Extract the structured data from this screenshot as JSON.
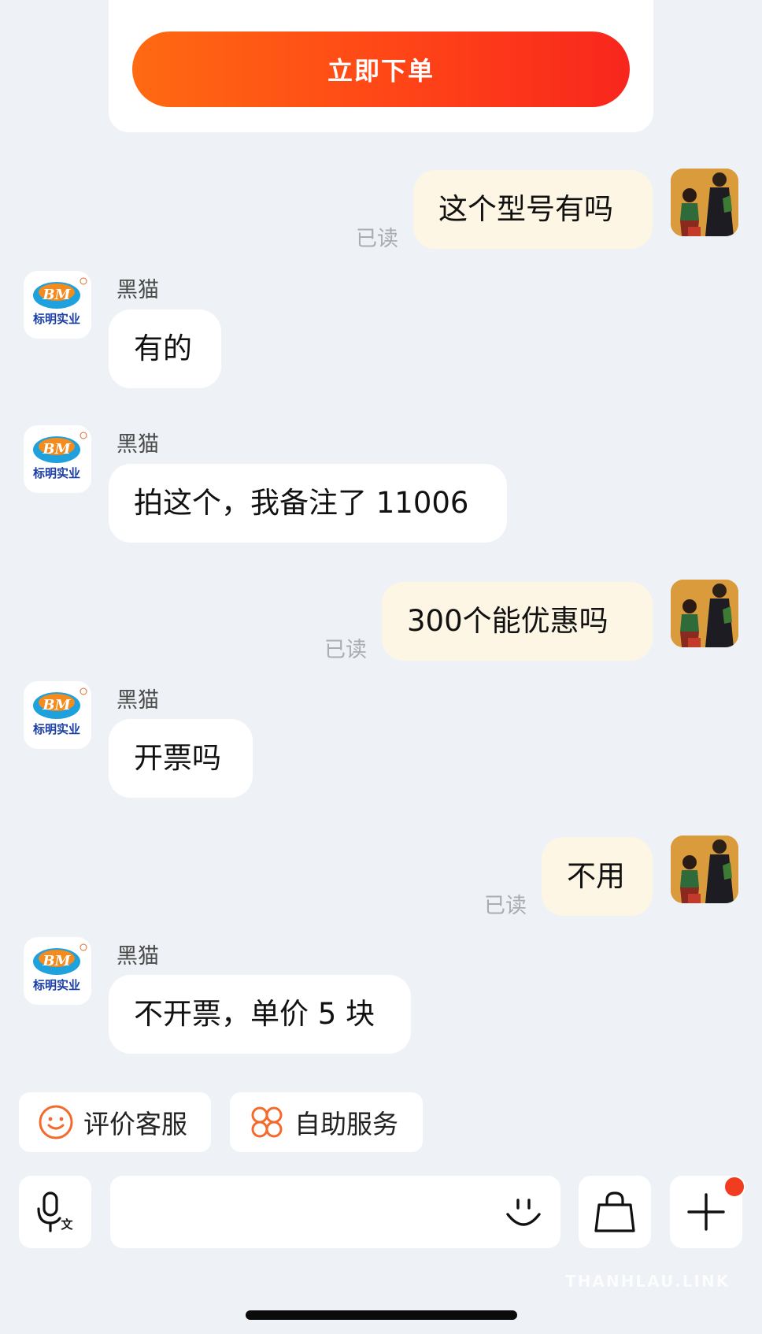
{
  "order_button": {
    "label": "立即下单"
  },
  "shop": {
    "logo_text_top": "BM",
    "logo_text_bottom": "标明实业"
  },
  "messages": [
    {
      "side": "out",
      "text": "这个型号有吗",
      "status": "已读"
    },
    {
      "side": "in",
      "sender": "黑猫",
      "text": "有的"
    },
    {
      "side": "in",
      "sender": "黑猫",
      "text": "拍这个，我备注了 11006"
    },
    {
      "side": "out",
      "text": "300个能优惠吗",
      "status": "已读"
    },
    {
      "side": "in",
      "sender": "黑猫",
      "text": "开票吗"
    },
    {
      "side": "out",
      "text": "不用",
      "status": "已读"
    },
    {
      "side": "in",
      "sender": "黑猫",
      "text": "不开票，单价 5 块"
    }
  ],
  "quick_actions": [
    {
      "label": "评价客服",
      "icon": "smiley-icon"
    },
    {
      "label": "自助服务",
      "icon": "self-service-icon"
    }
  ],
  "input_bar": {
    "voice_icon": "voice-input-icon",
    "voice_glyph": "文",
    "placeholder": "",
    "emoji_icon": "emoji-icon",
    "bag_icon": "shopping-bag-icon",
    "plus_icon": "plus-icon",
    "has_notification_dot": true
  },
  "watermark": "THANHLAU.LINK",
  "colors": {
    "accent_start": "#ff6a12",
    "accent_end": "#f8261d",
    "background": "#eef2f7",
    "outgoing_bubble": "#fdf6e4",
    "incoming_bubble": "#ffffff",
    "icon_orange": "#f36a2c"
  }
}
